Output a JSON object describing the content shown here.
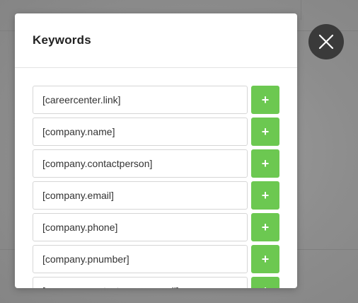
{
  "modal": {
    "title": "Keywords",
    "keywords": [
      {
        "value": "[careercenter.link]",
        "add_label": "+"
      },
      {
        "value": "[company.name]",
        "add_label": "+"
      },
      {
        "value": "[company.contactperson]",
        "add_label": "+"
      },
      {
        "value": "[company.email]",
        "add_label": "+"
      },
      {
        "value": "[company.phone]",
        "add_label": "+"
      },
      {
        "value": "[company.pnumber]",
        "add_label": "+"
      },
      {
        "value": "[company.contactperson.email]",
        "add_label": "+"
      }
    ]
  },
  "close_button": {
    "icon": "close-icon"
  },
  "colors": {
    "add_button": "#6cc851",
    "close_button": "#3a3a3a",
    "overlay": "#8a8a8a"
  }
}
